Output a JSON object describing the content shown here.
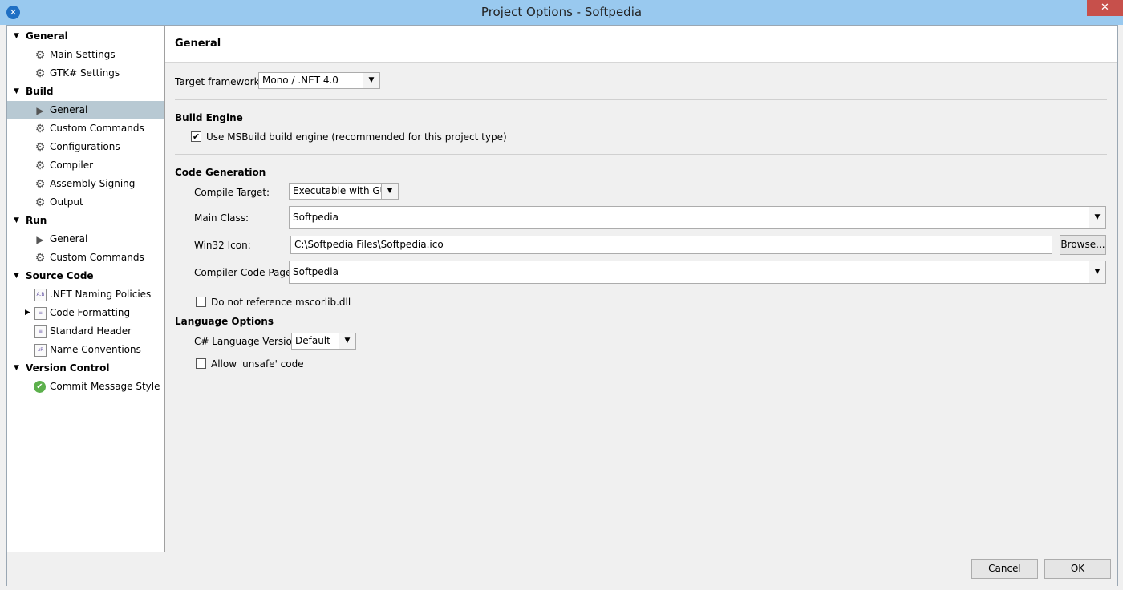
{
  "window": {
    "title": "Project Options - Softpedia",
    "app_icon": "monodevelop-icon",
    "close_glyph": "✕"
  },
  "sidebar": {
    "groups": [
      {
        "label": "General",
        "items": [
          {
            "label": "Main Settings",
            "icon": "gear-icon"
          },
          {
            "label": "GTK# Settings",
            "icon": "gear-icon"
          }
        ]
      },
      {
        "label": "Build",
        "items": [
          {
            "label": "General",
            "icon": "play-icon",
            "selected": true
          },
          {
            "label": "Custom Commands",
            "icon": "gear-icon"
          },
          {
            "label": "Configurations",
            "icon": "gear-icon"
          },
          {
            "label": "Compiler",
            "icon": "gear-icon"
          },
          {
            "label": "Assembly Signing",
            "icon": "gear-icon"
          },
          {
            "label": "Output",
            "icon": "gear-icon"
          }
        ]
      },
      {
        "label": "Run",
        "items": [
          {
            "label": "General",
            "icon": "play-icon"
          },
          {
            "label": "Custom Commands",
            "icon": "gear-icon"
          }
        ]
      },
      {
        "label": "Source Code",
        "items": [
          {
            "label": ".NET Naming Policies",
            "icon": "naming-policy-icon",
            "icon_text": "A.B"
          },
          {
            "label": "Code Formatting",
            "icon": "code-format-icon",
            "icon_text": "≡"
          },
          {
            "label": "Standard Header",
            "icon": "document-icon",
            "icon_text": "≡"
          },
          {
            "label": "Name Conventions",
            "icon": "name-convention-icon",
            "icon_text": ".ıR"
          }
        ]
      },
      {
        "label": "Version Control",
        "items": [
          {
            "label": "Commit Message Style",
            "icon": "check-circle-icon"
          }
        ]
      }
    ]
  },
  "content": {
    "title": "General",
    "target_framework": {
      "label": "Target framework:",
      "value": "Mono / .NET 4.0"
    },
    "build_engine": {
      "title": "Build Engine",
      "msbuild_label": "Use MSBuild build engine (recommended for this project type)",
      "msbuild_checked": true
    },
    "code_generation": {
      "title": "Code Generation",
      "compile_target_label": "Compile Target:",
      "compile_target_value": "Executable with GUI",
      "main_class_label": "Main Class:",
      "main_class_value": "Softpedia",
      "win32_icon_label": "Win32 Icon:",
      "win32_icon_value": "C:\\Softpedia Files\\Softpedia.ico",
      "browse_label": "Browse...",
      "code_page_label": "Compiler Code Page:",
      "code_page_value": "Softpedia",
      "no_mscorlib_label": "Do not reference mscorlib.dll",
      "no_mscorlib_checked": false
    },
    "language_options": {
      "title": "Language Options",
      "lang_version_label": "C# Language Version:",
      "lang_version_value": "Default",
      "unsafe_label": "Allow 'unsafe' code",
      "unsafe_checked": false
    }
  },
  "footer": {
    "cancel_label": "Cancel",
    "ok_label": "OK"
  },
  "glyphs": {
    "dropdown": "▼",
    "check": "✔",
    "expanded": "▼",
    "collapsed": "▶"
  },
  "colors": {
    "titlebar": "#99c9ef",
    "close": "#c7504b",
    "selected_row": "#b8c9d3"
  }
}
